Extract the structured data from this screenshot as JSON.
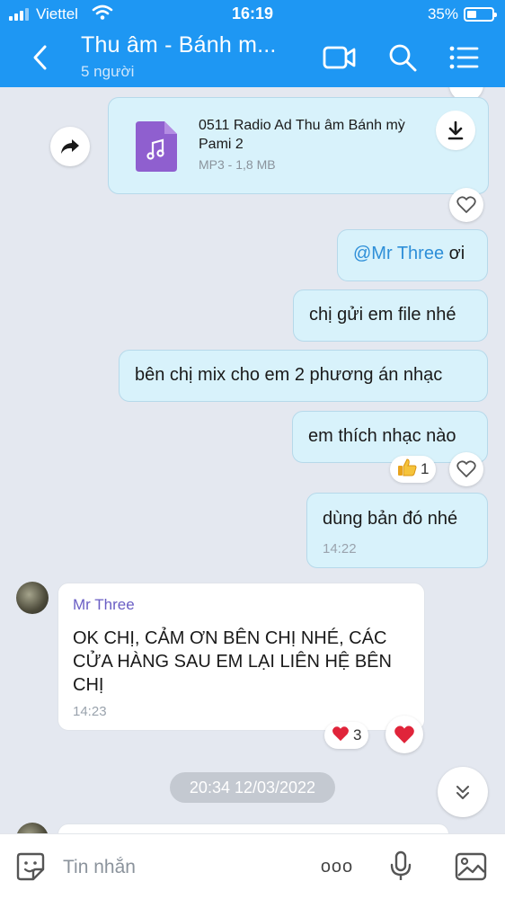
{
  "status_bar": {
    "carrier": "Viettel",
    "time": "16:19",
    "battery": "35%"
  },
  "header": {
    "title": "Thu âm - Bánh m...",
    "subtitle": "5 người"
  },
  "messages": {
    "file": {
      "name": "0511 Radio Ad Thu âm Bánh mỳ Pami 2",
      "meta": "MP3 - 1,8 MB"
    },
    "m1": {
      "mention": "@Mr Three",
      "text": " ơi"
    },
    "m2": {
      "text": "chị gửi em file nhé"
    },
    "m3": {
      "text": "bên chị mix cho em 2 phương án nhạc"
    },
    "m4": {
      "text": "em thích nhạc nào",
      "reaction_count": "1"
    },
    "m5": {
      "text": "dùng bản đó nhé",
      "time": "14:22"
    },
    "incoming": {
      "sender": "Mr Three",
      "text": "OK CHỊ, CẢM ƠN BÊN CHỊ NHÉ, CÁC CỬA HÀNG SAU EM LẠI LIÊN HỆ BÊN CHỊ",
      "time": "14:23",
      "reaction_count": "3"
    },
    "date_separator": "20:34 12/03/2022"
  },
  "composer": {
    "placeholder": "Tin nhắn",
    "more_label": "ooo"
  },
  "colors": {
    "header": "#1e97f3",
    "outgoing_bubble": "#d8f2fb",
    "mention": "#2e8fd8",
    "sender_name": "#6a5ec4",
    "heart": "#e0243a"
  }
}
